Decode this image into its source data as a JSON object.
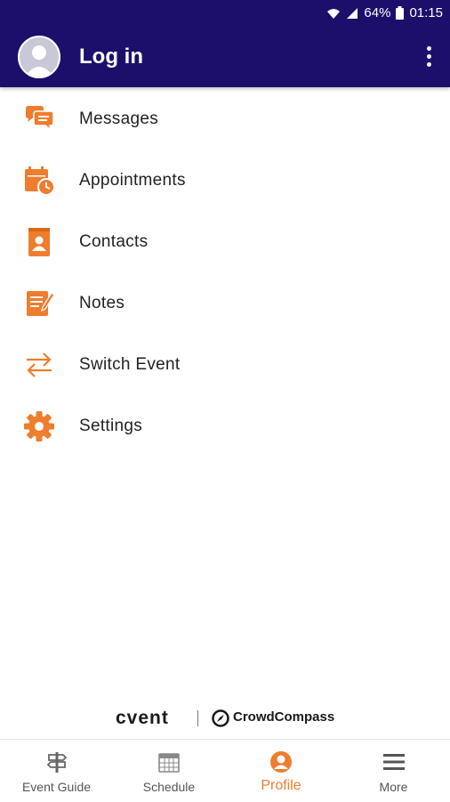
{
  "status": {
    "battery": "64%",
    "time": "01:15"
  },
  "appbar": {
    "title": "Log in"
  },
  "menu": {
    "items": [
      {
        "label": "Messages",
        "icon": "chat-icon"
      },
      {
        "label": "Appointments",
        "icon": "calendar-clock-icon"
      },
      {
        "label": "Contacts",
        "icon": "contact-book-icon"
      },
      {
        "label": "Notes",
        "icon": "note-icon"
      },
      {
        "label": "Switch Event",
        "icon": "swap-arrows-icon"
      },
      {
        "label": "Settings",
        "icon": "gear-icon"
      }
    ]
  },
  "branding": {
    "left": "cvent",
    "right": "CrowdCompass"
  },
  "tabs": [
    {
      "label": "Event Guide",
      "icon": "signpost-icon"
    },
    {
      "label": "Schedule",
      "icon": "calendar-icon"
    },
    {
      "label": "Profile",
      "icon": "profile-icon",
      "active": true
    },
    {
      "label": "More",
      "icon": "hamburger-icon"
    }
  ],
  "colors": {
    "primary": "#1c0f6b",
    "accent": "#ef7d2e"
  }
}
